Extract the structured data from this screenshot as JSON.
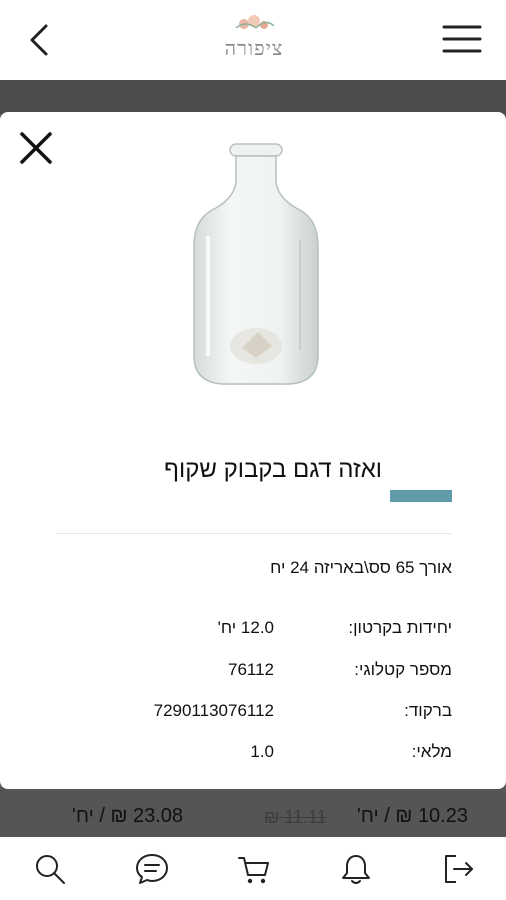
{
  "header": {
    "logo_text": "ציפורה",
    "back_icon": "chevron-left-icon",
    "menu_icon": "hamburger-menu-icon"
  },
  "product": {
    "title": "ואזה דגם בקבוק שקוף",
    "description": "אורך 65 סס\\באריזה 24 יח",
    "specs": [
      {
        "label": "יחידות בקרטון:",
        "value": "12.0 יח'"
      },
      {
        "label": "מספר קטלוגי:",
        "value": "76112"
      },
      {
        "label": "ברקוד:",
        "value": "7290113076112"
      },
      {
        "label": "מלאי:",
        "value": "1.0"
      }
    ],
    "accent_color": "#5f9aa8"
  },
  "background_prices": {
    "left": "23.08 ₪ / יח'",
    "old": "11.11 ₪",
    "right": "10.23 ₪ / יח'"
  },
  "tabbar": {
    "items": [
      {
        "icon": "search-icon"
      },
      {
        "icon": "chat-bubble-icon"
      },
      {
        "icon": "cart-icon"
      },
      {
        "icon": "bell-icon"
      },
      {
        "icon": "logout-icon"
      }
    ]
  }
}
